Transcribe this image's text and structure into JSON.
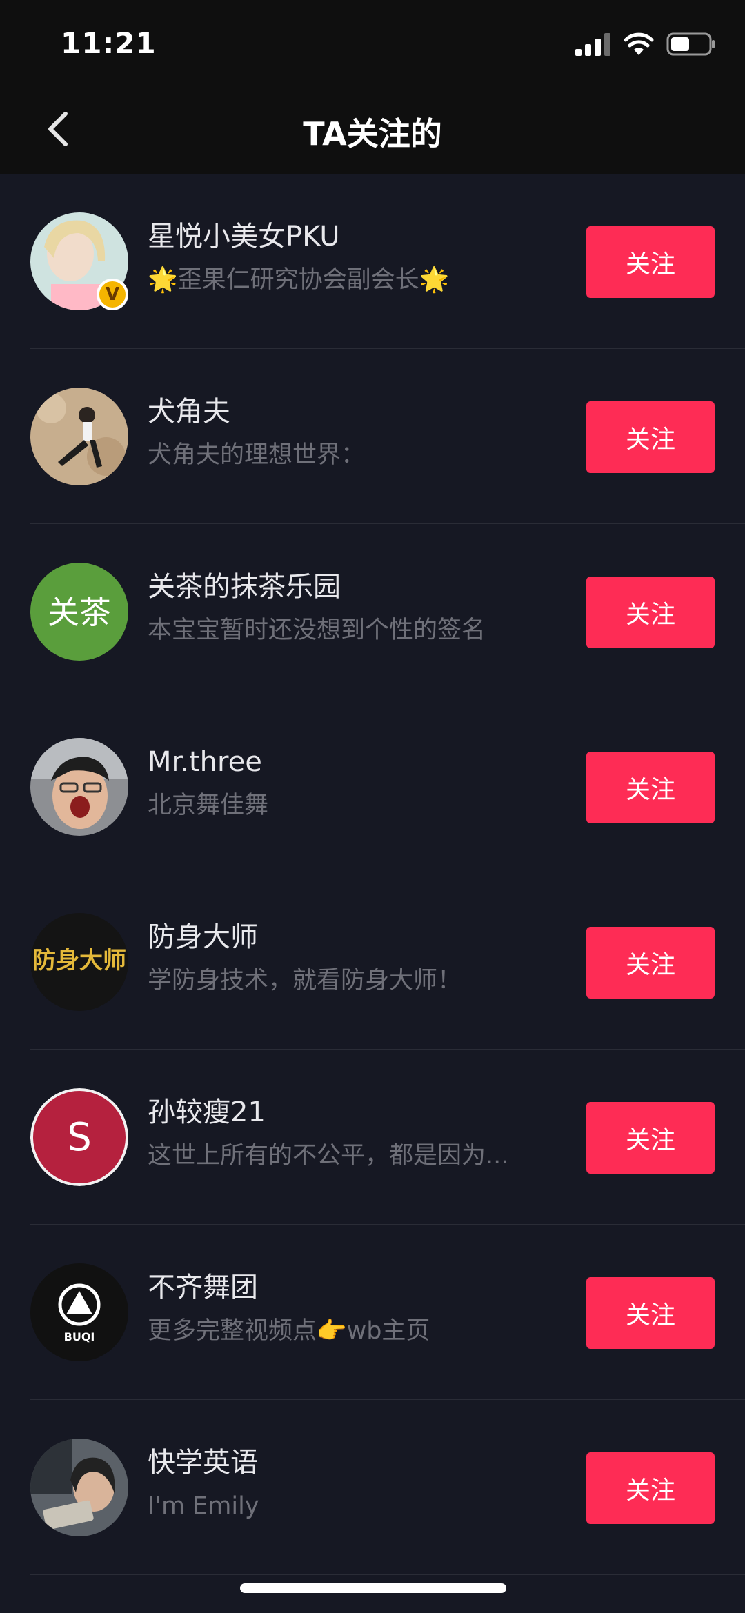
{
  "status_bar": {
    "time": "11:21"
  },
  "header": {
    "title": "TA关注的",
    "back_icon": "chevron-left-icon"
  },
  "colors": {
    "background": "#161823",
    "header_background": "#0f0f0f",
    "follow_button": "#fe2c55",
    "name_text": "#e8e8ec",
    "bio_text": "#6f7079"
  },
  "users": [
    {
      "name": "星悦小美女PKU",
      "bio": "🌟歪果仁研究协会副会长🌟",
      "button": "关注",
      "verified": true
    },
    {
      "name": "犬角夫",
      "bio": "犬角夫的理想世界：",
      "button": "关注",
      "verified": false
    },
    {
      "name": "关茶的抹茶乐园",
      "bio": "本宝宝暂时还没想到个性的签名",
      "button": "关注",
      "verified": false,
      "avatar_text": "关茶"
    },
    {
      "name": "Mr.three",
      "bio": "北京舞佳舞",
      "button": "关注",
      "verified": false
    },
    {
      "name": "防身大师",
      "bio": "学防身技术，就看防身大师！",
      "button": "关注",
      "verified": false,
      "avatar_text": "防身大师"
    },
    {
      "name": "孙较瘦21",
      "bio": "这世上所有的不公平，都是因为...",
      "button": "关注",
      "verified": false,
      "avatar_text": "S"
    },
    {
      "name": "不齐舞团",
      "bio": "更多完整视频点👉wb主页",
      "button": "关注",
      "verified": false,
      "avatar_text": "BUQI"
    },
    {
      "name": "快学英语",
      "bio": "I'm Emily",
      "button": "关注",
      "verified": false
    }
  ]
}
